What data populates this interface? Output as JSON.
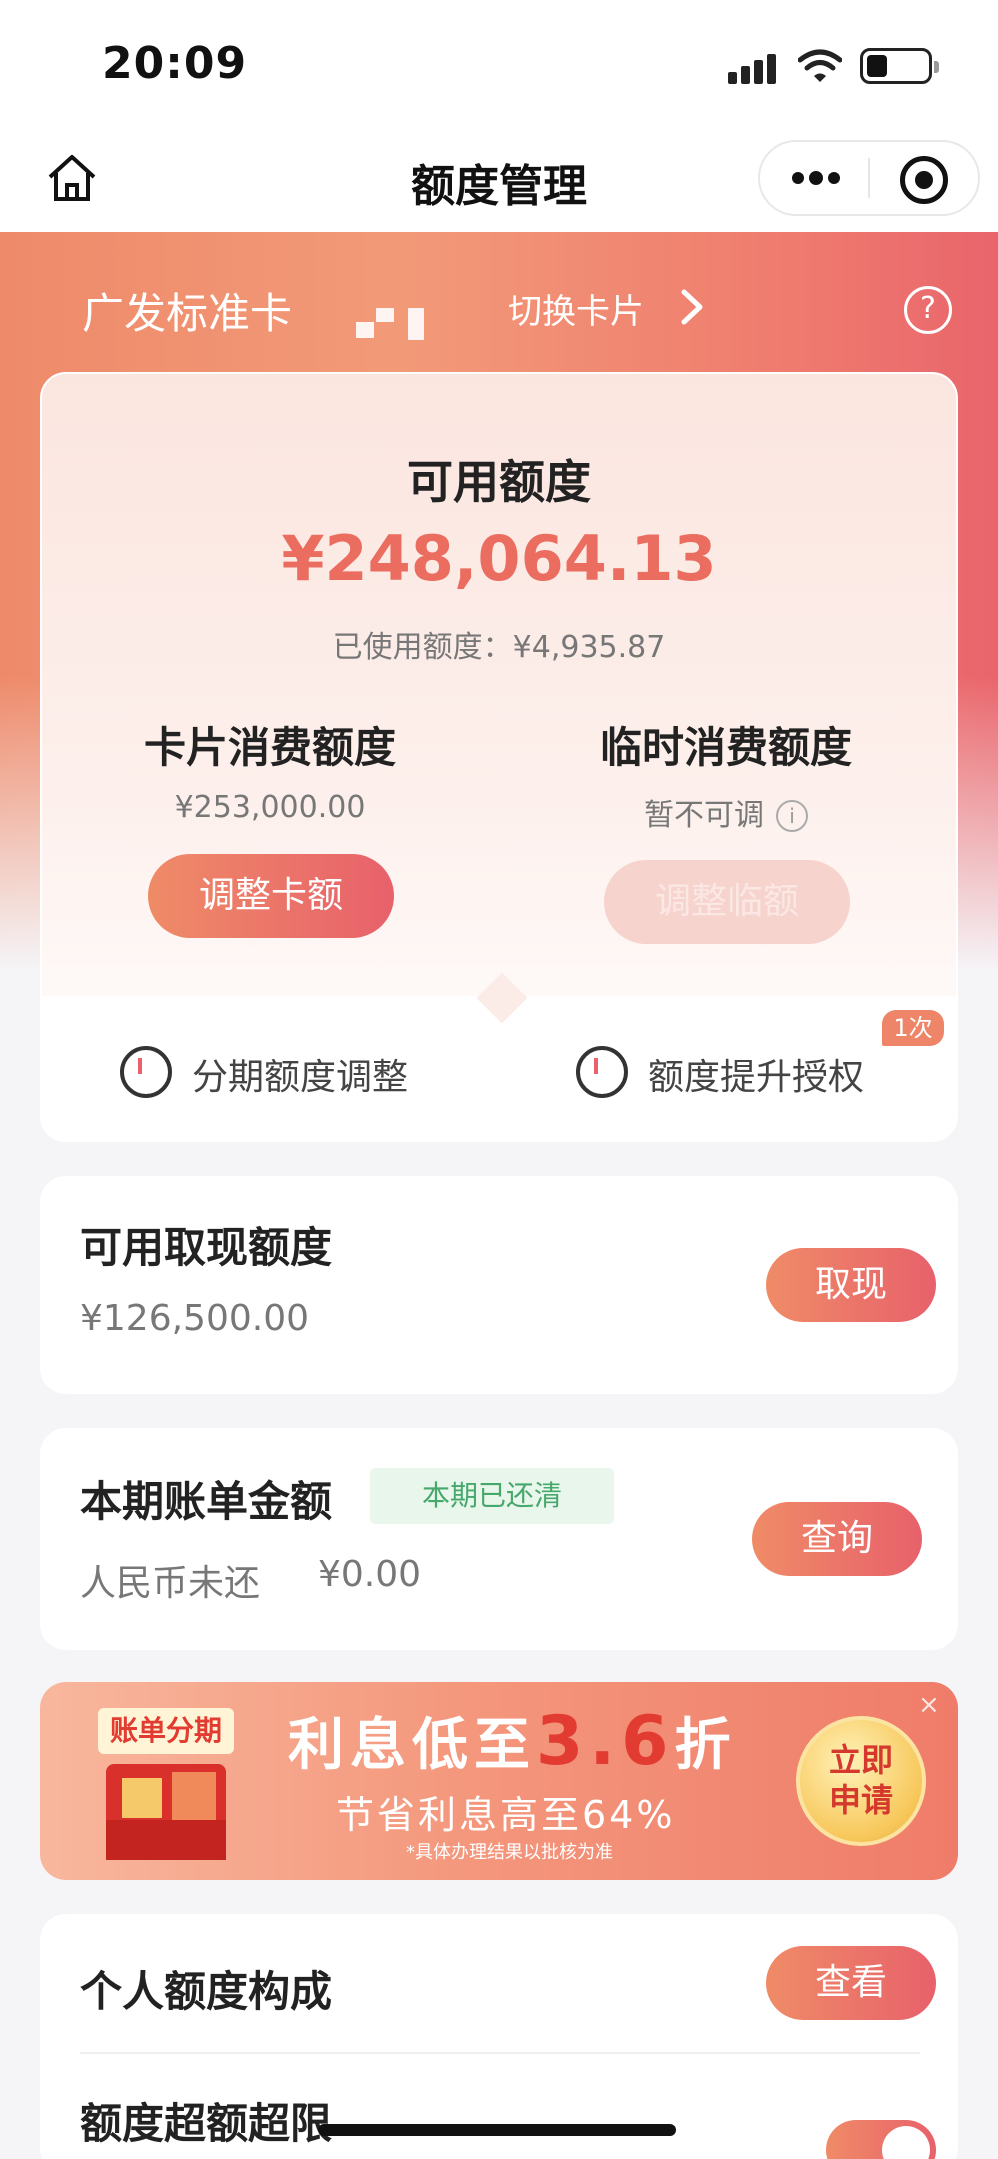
{
  "status_bar": {
    "time": "20:09"
  },
  "nav": {
    "title": "额度管理"
  },
  "header": {
    "card_name": "广发标准卡",
    "switch_card": "切换卡片",
    "help": "?"
  },
  "credit": {
    "available_label": "可用额度",
    "available_amount": "¥248,064.13",
    "used_line": "已使用额度：¥4,935.87",
    "card_limit_title": "卡片消费额度",
    "card_limit_value": "¥253,000.00",
    "card_limit_button": "调整卡额",
    "temp_limit_title": "临时消费额度",
    "temp_limit_value": "暂不可调",
    "temp_limit_button": "调整临额",
    "installment_label": "分期额度调整",
    "raise_label": "额度提升授权",
    "raise_badge": "1次"
  },
  "cash": {
    "title": "可用取现额度",
    "amount": "¥126,500.00",
    "button": "取现"
  },
  "bill": {
    "title": "本期账单金额",
    "status_tag": "本期已还清",
    "currency_label": "人民币未还",
    "amount": "¥0.00",
    "button": "查询"
  },
  "promo": {
    "badge": "账单分期",
    "headline_prefix": "利息低至",
    "headline_num": "3.6",
    "headline_suffix": "折",
    "sub": "节省利息高至64%",
    "note": "*具体办理结果以批核为准",
    "apply_line1": "立即",
    "apply_line2": "申请",
    "close": "×"
  },
  "composition": {
    "title": "个人额度构成",
    "button": "查看",
    "over_limit_title": "额度超额超限"
  },
  "colors": {
    "accent_start": "#ef8b67",
    "accent_end": "#e8616b",
    "amount": "#ea6d5f",
    "paid_green": "#47a86b"
  }
}
